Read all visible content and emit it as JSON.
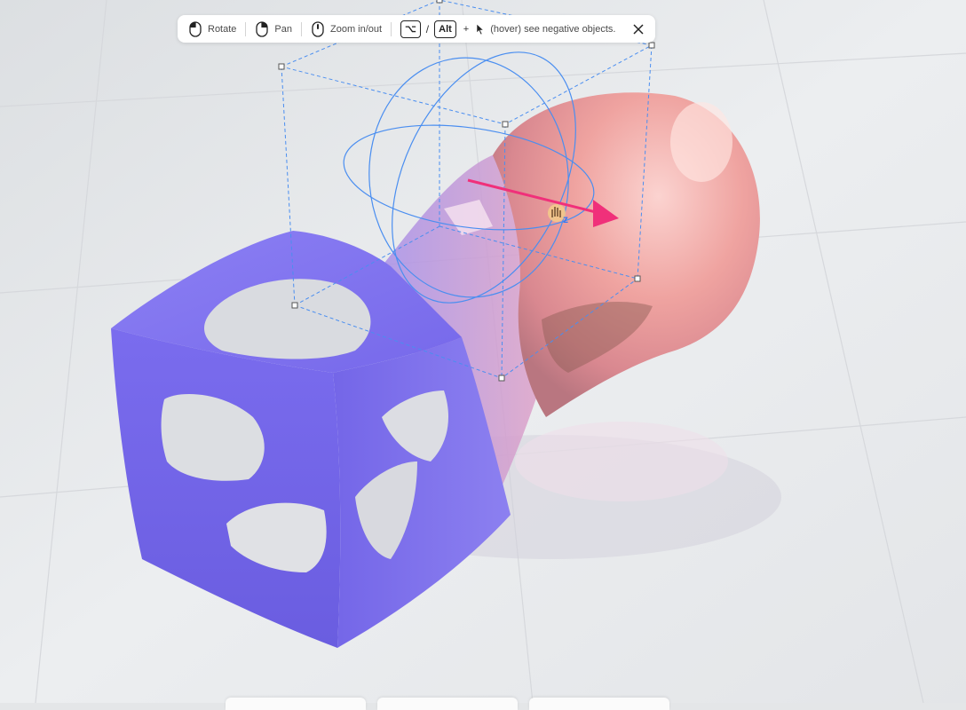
{
  "hints": {
    "rotate_label": "Rotate",
    "pan_label": "Pan",
    "zoom_label": "Zoom in/out",
    "option_key": "⌥",
    "slash": "/",
    "alt_key": "Alt",
    "plus": "+",
    "negative_label": "(hover) see negative objects."
  },
  "gizmo": {
    "axis_label": "z"
  },
  "bottom_tabs": [
    "",
    "",
    ""
  ],
  "colors": {
    "cube": "#7a6ef0",
    "blob": "#f0a0a4",
    "gizmo_line": "#4a8ef0",
    "translate_arrow": "#f0307a",
    "floor": "#e4e6e8"
  }
}
